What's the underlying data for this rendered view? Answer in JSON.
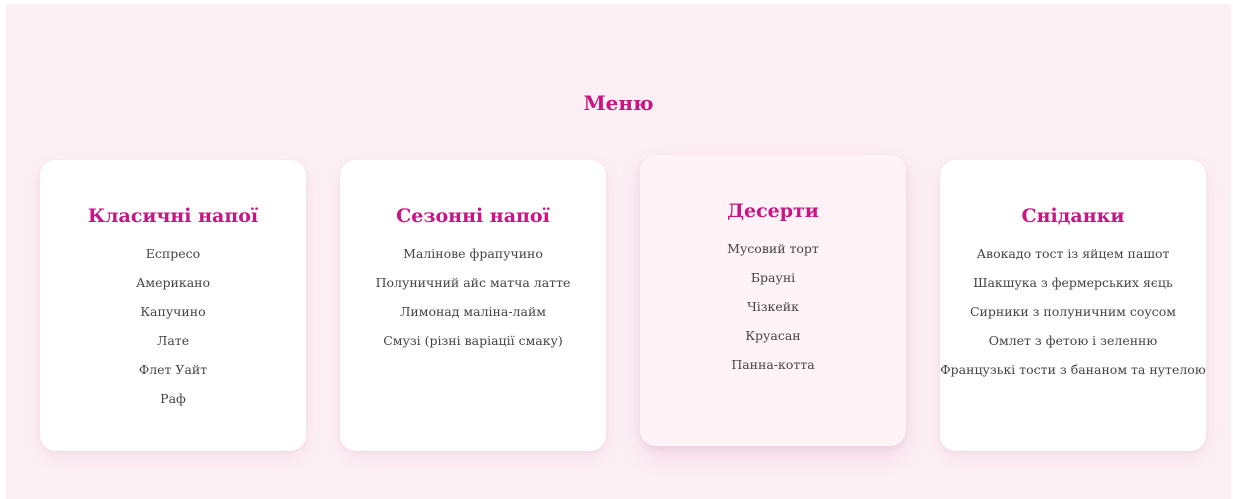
{
  "menu": {
    "title": "Меню",
    "sections": [
      {
        "title": "Класичні напої",
        "items": [
          "Еспресо",
          "Американо",
          "Капучино",
          "Лате",
          "Флет Уайт",
          "Раф"
        ]
      },
      {
        "title": "Сезонні напої",
        "items": [
          "Малінове фрапучино",
          "Полуничний айс матча латте",
          "Лимонад маліна-лайм",
          "Смузі (різні варіації смаку)"
        ]
      },
      {
        "title": "Десерти",
        "items": [
          "Мусовий торт",
          "Брауні",
          "Чізкейк",
          "Круасан",
          "Панна-котта"
        ]
      },
      {
        "title": "Сніданки",
        "items": [
          "Авокадо тост із яйцем пашот",
          "Шакшука з фермерських яєць",
          "Сирники з полуничним соусом",
          "Омлет з фетою і зеленню",
          "Французькі тости з бананом та нутелою"
        ]
      }
    ]
  },
  "colors": {
    "accent": "#c71585",
    "page_background": "#fcf0f4",
    "card_background": "#ffffff",
    "card_highlight_background": "#fff3f8",
    "item_text": "#444444"
  }
}
